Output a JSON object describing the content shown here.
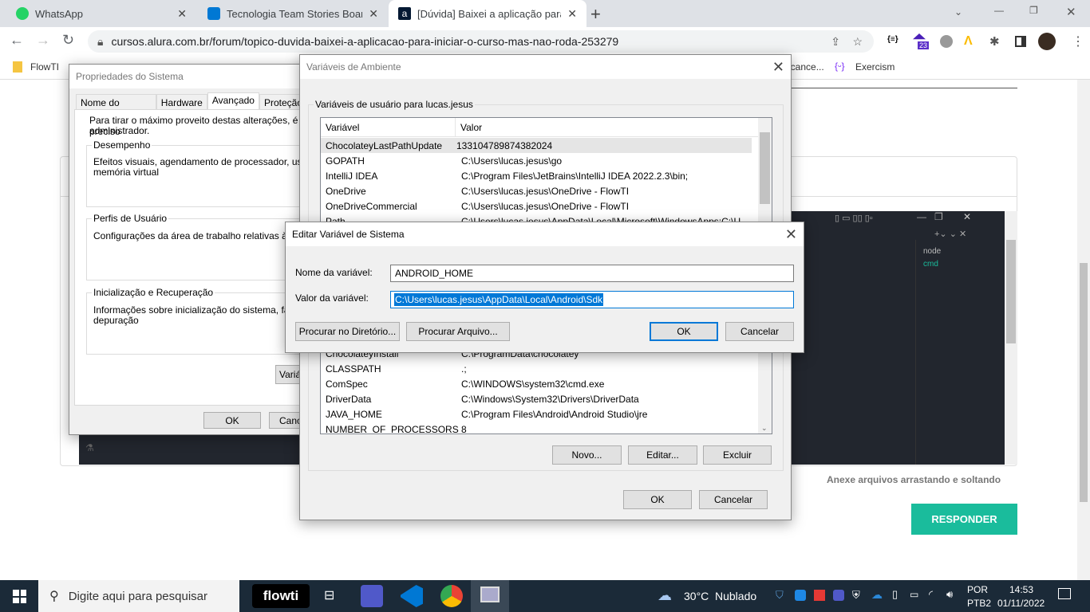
{
  "browser": {
    "tabs": [
      {
        "title": "WhatsApp",
        "icon": "whatsapp-icon",
        "color": "#25d366"
      },
      {
        "title": "Tecnologia Team Stories Board - ",
        "icon": "azure-devops-icon",
        "color": "#0078d4"
      },
      {
        "title": "[Dúvida] Baixei a aplicação para i",
        "icon": "alura-icon",
        "color": "#051933",
        "active": true
      }
    ],
    "new_tab": "+",
    "url": "cursos.alura.com.br/forum/topico-duvida-baixei-a-aplicacao-para-iniciar-o-curso-mas-nao-roda-253279",
    "extension_badge": "23",
    "bookmarks": [
      {
        "label": "FlowTI",
        "icon": "folder-icon"
      },
      {
        "label": "lcance...",
        "icon": ""
      },
      {
        "label": "Exercism",
        "icon": "exercism-icon"
      }
    ]
  },
  "page": {
    "attach_hint": "Anexe arquivos arrastando e soltando",
    "reply_button": "RESPONDER",
    "accent": "#1abc9c",
    "terminal_tabs": [
      "node",
      "cmd"
    ]
  },
  "system_properties": {
    "title": "Propriedades do Sistema",
    "tabs": [
      "Nome do Computador",
      "Hardware",
      "Avançado",
      "Proteção"
    ],
    "intro": "Para tirar o máximo proveito destas alterações, é preciso",
    "intro2": "administrador.",
    "groups": [
      {
        "label": "Desempenho",
        "text": "Efeitos visuais, agendamento de processador, uso de m",
        "text2": "memória virtual"
      },
      {
        "label": "Perfis de Usuário",
        "text": "Configurações da área de trabalho relativas à entra",
        "text2": ""
      },
      {
        "label": "Inicialização e Recuperação",
        "text": "Informações sobre inicialização do sistema, falha de",
        "text2": "depuração"
      }
    ],
    "env_button": "Variáv",
    "ok": "OK",
    "cancel": "Canc"
  },
  "env_vars": {
    "title": "Variáveis de Ambiente",
    "user_group": "Variáveis de usuário para lucas.jesus",
    "col_var": "Variável",
    "col_val": "Valor",
    "user_rows": [
      {
        "name": "ChocolateyLastPathUpdate",
        "value": "133104789874382024"
      },
      {
        "name": "GOPATH",
        "value": "C:\\Users\\lucas.jesus\\go"
      },
      {
        "name": "IntelliJ IDEA",
        "value": "C:\\Program Files\\JetBrains\\IntelliJ IDEA 2022.2.3\\bin;"
      },
      {
        "name": "OneDrive",
        "value": "C:\\Users\\lucas.jesus\\OneDrive - FlowTI"
      },
      {
        "name": "OneDriveCommercial",
        "value": "C:\\Users\\lucas.jesus\\OneDrive - FlowTI"
      },
      {
        "name": "Path",
        "value": "C:\\Users\\lucas.jesus\\AppData\\Local\\Microsoft\\WindowsApps;C:\\U"
      }
    ],
    "system_rows": [
      {
        "name": "ChocolateyInstall",
        "value": "C:\\ProgramData\\chocolatey"
      },
      {
        "name": "CLASSPATH",
        "value": ".;"
      },
      {
        "name": "ComSpec",
        "value": "C:\\WINDOWS\\system32\\cmd.exe"
      },
      {
        "name": "DriverData",
        "value": "C:\\Windows\\System32\\Drivers\\DriverData"
      },
      {
        "name": "JAVA_HOME",
        "value": "C:\\Program Files\\Android\\Android Studio\\jre"
      },
      {
        "name": "NUMBER_OF_PROCESSORS",
        "value": "8"
      }
    ],
    "new": "Novo...",
    "edit": "Editar...",
    "delete": "Excluir",
    "ok": "OK",
    "cancel": "Cancelar"
  },
  "edit_var": {
    "title": "Editar Variável de Sistema",
    "name_label": "Nome da variável:",
    "name_value": "ANDROID_HOME",
    "value_label": "Valor da variável:",
    "value_value": "C:\\Users\\lucas.jesus\\AppData\\Local\\Android\\Sdk",
    "browse_dir": "Procurar no Diretório...",
    "browse_file": "Procurar Arquivo...",
    "ok": "OK",
    "cancel": "Cancelar"
  },
  "taskbar": {
    "search_placeholder": "Digite aqui para pesquisar",
    "flowti": "flowti",
    "weather_temp": "30°C",
    "weather_text": "Nublado",
    "lang": "POR",
    "layout": "PTB2",
    "time": "14:53",
    "date": "01/11/2022"
  }
}
